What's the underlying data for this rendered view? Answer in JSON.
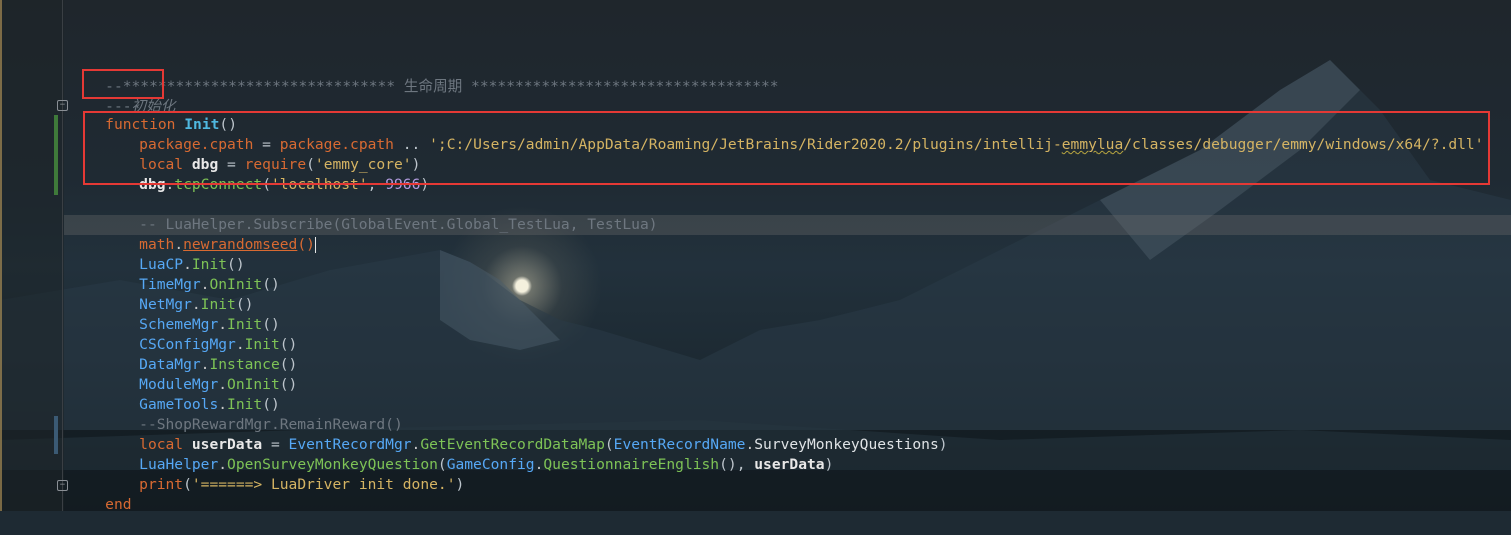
{
  "editor": {
    "lines": {
      "l1_comment": "--******************************* 生命周期 ***********************************",
      "l2_dash": "---",
      "l2_comment": "初始化",
      "l3_kw": "function",
      "l3_name": "Init",
      "l3_paren": "()",
      "l4_a": "package.cpath",
      "l4_eq": " = ",
      "l4_b": "package.cpath",
      "l4_concat": " .. ",
      "l4_str_a": "';C:/Users/admin/AppData/Roaming/JetBrains/Rider2020.2/plugins/intellij-",
      "l4_str_b": "emmylua",
      "l4_str_c": "/classes/debugger/emmy/windows/x64/?.dll'",
      "l5_kw": "local",
      "l5_var": " dbg",
      "l5_eq": " = ",
      "l5_fn": "require",
      "l5_args_open": "(",
      "l5_str": "'emmy_core'",
      "l5_args_close": ")",
      "l6_obj": "dbg",
      "l6_dot": ".",
      "l6_mth": "tcpConnect",
      "l6_open": "(",
      "l6_str": "'localhost'",
      "l6_comma": ", ",
      "l6_num": "9966",
      "l6_close": ")",
      "l8_comment": "-- LuaHelper.Subscribe(GlobalEvent.Global_TestLua, TestLua)",
      "l9_lib": "math",
      "l9_dot": ".",
      "l9_mth": "newrandomseed",
      "l9_paren": "()",
      "calls": [
        {
          "obj": "LuaCP",
          "mth": "Init",
          "paren": "()"
        },
        {
          "obj": "TimeMgr",
          "mth": "OnInit",
          "paren": "()"
        },
        {
          "obj": "NetMgr",
          "mth": "Init",
          "paren": "()"
        },
        {
          "obj": "SchemeMgr",
          "mth": "Init",
          "paren": "()"
        },
        {
          "obj": "CSConfigMgr",
          "mth": "Init",
          "paren": "()"
        },
        {
          "obj": "DataMgr",
          "mth": "Instance",
          "paren": "()"
        },
        {
          "obj": "ModuleMgr",
          "mth": "OnInit",
          "paren": "()"
        },
        {
          "obj": "GameTools",
          "mth": "Init",
          "paren": "()"
        }
      ],
      "l18_comment": "--ShopRewardMgr.RemainReward()",
      "l19_kw": "local",
      "l19_var": " userData",
      "l19_eq": " = ",
      "l19_obj": "EventRecordMgr",
      "l19_mth": "GetEventRecordDataMap",
      "l19_open": "(",
      "l19_arg_obj": "EventRecordName",
      "l19_arg_field": "SurveyMonkeyQuestions",
      "l19_close": ")",
      "l20_obj": "LuaHelper",
      "l20_mth": "OpenSurveyMonkeyQuestion",
      "l20_open": "(",
      "l20_arg_obj": "GameConfig",
      "l20_arg_mth": "QuestionnaireEnglish",
      "l20_arg_paren": "()",
      "l20_comma": ", ",
      "l20_var": "userData",
      "l20_close": ")",
      "l21_fn": "print",
      "l21_open": "(",
      "l21_str": "'======> LuaDriver init done.'",
      "l21_close": ")",
      "l22_kw": "end"
    },
    "colors": {
      "keyword": "#d86a32",
      "function_name": "#4fb8e0",
      "class": "#56a8f5",
      "method": "#7ec356",
      "string": "#d5b463",
      "number": "#b39ce0",
      "comment": "#6e7780",
      "highlight_box": "#e53935"
    }
  }
}
